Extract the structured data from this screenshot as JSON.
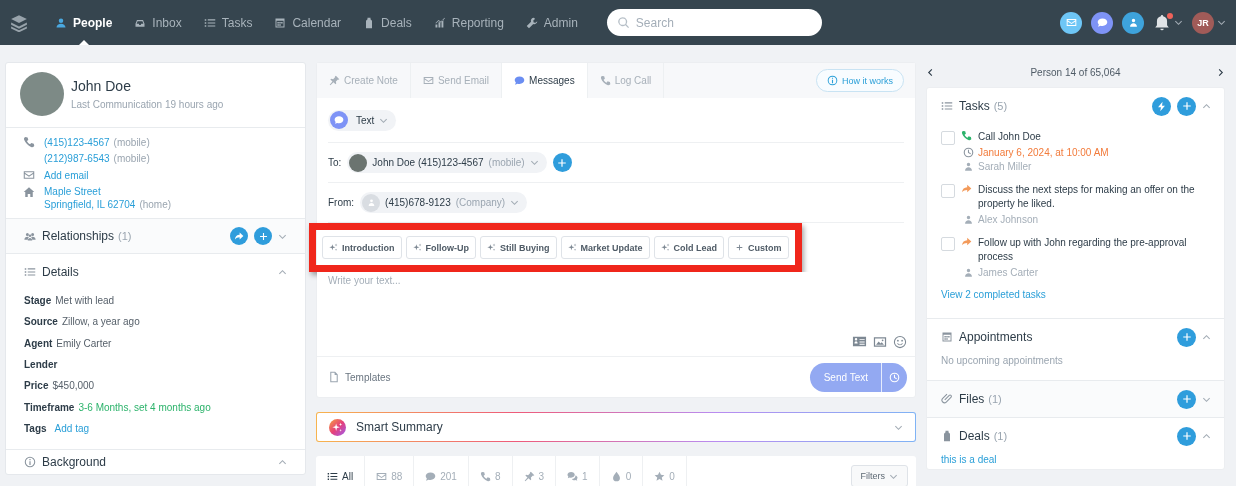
{
  "nav": {
    "items": [
      {
        "label": "People",
        "selected": true
      },
      {
        "label": "Inbox",
        "selected": false
      },
      {
        "label": "Tasks",
        "selected": false
      },
      {
        "label": "Calendar",
        "selected": false
      },
      {
        "label": "Deals",
        "selected": false
      },
      {
        "label": "Reporting",
        "selected": false
      },
      {
        "label": "Admin",
        "selected": false
      }
    ],
    "search_placeholder": "Search",
    "has_notification": true,
    "user_initials": "JR"
  },
  "contact": {
    "name": "John Doe",
    "last_communication": "Last Communication 19 hours ago",
    "phones": [
      {
        "number": "(415)123-4567",
        "type": "(mobile)"
      },
      {
        "number": "(212)987-6543",
        "type": "(mobile)"
      }
    ],
    "email_action": "Add email",
    "address": {
      "street": "Maple Street",
      "city": "Springfield, IL 62704",
      "type": "(home)"
    }
  },
  "relationships": {
    "title": "Relationships",
    "count": "(1)",
    "expanded": false
  },
  "details": {
    "title": "Details",
    "expanded": true,
    "fields": [
      {
        "label": "Stage",
        "value": "Met with lead",
        "kind": "text"
      },
      {
        "label": "Source",
        "value": "Zillow, a year ago",
        "kind": "text"
      },
      {
        "label": "Agent",
        "value": "Emily Carter",
        "kind": "text"
      },
      {
        "label": "Lender"
      },
      {
        "label": "Price",
        "value": "$450,000",
        "kind": "text"
      },
      {
        "label": "Timeframe",
        "value": "3-6 Months, set 4 months ago",
        "kind": "status"
      },
      {
        "label": "Tags",
        "value": "Add tag",
        "kind": "link"
      }
    ]
  },
  "background": {
    "title": "Background",
    "expanded": true
  },
  "composer": {
    "tabs": [
      {
        "label": "Create Note",
        "selected": false
      },
      {
        "label": "Send Email",
        "selected": false
      },
      {
        "label": "Messages",
        "selected": true
      },
      {
        "label": "Log Call",
        "selected": false
      }
    ],
    "how_it_works": "How it works",
    "channel": "Text",
    "to": {
      "label": "To:",
      "name": "John Doe",
      "phone": "(415)123-4567",
      "type": "(mobile)"
    },
    "from": {
      "label": "From:",
      "phone": "(415)678-9123",
      "type": "(Company)"
    },
    "quick_replies": {
      "highlighted": true,
      "items": [
        {
          "label": "Introduction",
          "kind": "ai"
        },
        {
          "label": "Follow-Up",
          "kind": "ai"
        },
        {
          "label": "Still Buying",
          "kind": "ai"
        },
        {
          "label": "Market Update",
          "kind": "ai"
        },
        {
          "label": "Cold Lead",
          "kind": "ai"
        },
        {
          "label": "Custom",
          "kind": "custom"
        }
      ]
    },
    "placeholder": "Write your text...",
    "templates": "Templates",
    "send": "Send Text",
    "send_disabled": true
  },
  "smart_summary": {
    "title": "Smart Summary"
  },
  "activity": {
    "tabs": [
      {
        "label": "All",
        "selected": true
      },
      {
        "label": "88",
        "selected": false
      },
      {
        "label": "201",
        "selected": false
      },
      {
        "label": "8",
        "selected": false
      },
      {
        "label": "3",
        "selected": false
      },
      {
        "label": "1",
        "selected": false
      },
      {
        "label": "0",
        "selected": false
      },
      {
        "label": "0",
        "selected": false
      }
    ],
    "filters": "Filters"
  },
  "pager": "Person 14 of 65,064",
  "tasks": {
    "title": "Tasks",
    "count": "(5)",
    "expanded": true,
    "items": [
      {
        "kind": "call",
        "title": "Call John Doe",
        "due": "January 6, 2024, at 10:00 AM",
        "assignee": "Sarah Miller",
        "checked": false
      },
      {
        "kind": "follow_up",
        "title": "Discuss the next steps for making an offer on the property he liked.",
        "assignee": "Alex Johnson",
        "checked": false
      },
      {
        "kind": "follow_up",
        "title": "Follow up with John regarding the pre-approval process",
        "assignee": "James Carter",
        "checked": false
      }
    ],
    "completed_link": "View 2 completed tasks"
  },
  "appointments": {
    "title": "Appointments",
    "expanded": true,
    "empty": "No upcoming appointments"
  },
  "files": {
    "title": "Files",
    "count": "(1)",
    "expanded": false
  },
  "deals": {
    "title": "Deals",
    "count": "(1)",
    "expanded": true,
    "items": [
      "this is a deal"
    ]
  }
}
